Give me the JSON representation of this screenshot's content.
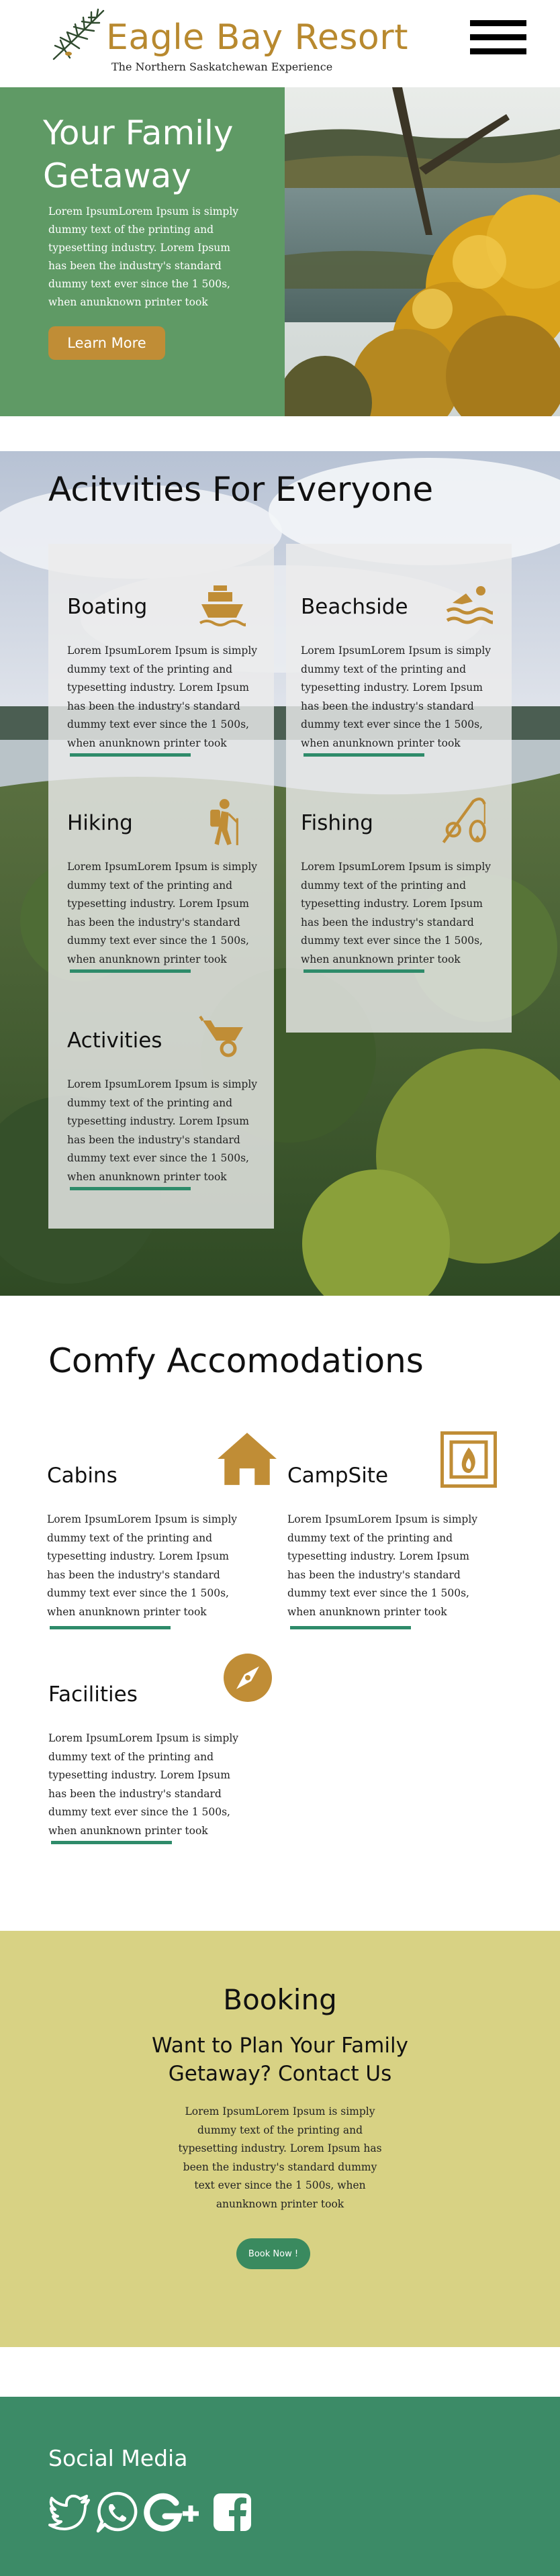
{
  "header": {
    "title": "Eagle Bay Resort",
    "subtitle": "The Northern Saskatchewan Experience",
    "menu_icon": "hamburger-menu-icon"
  },
  "hero": {
    "title": "Your Family Getaway",
    "text": "Lorem IpsumLorem Ipsum is simply  dummy text of the printing and typesetting industry. Lorem Ipsum has been the industry's standard dummy text ever since the 1 500s, when anunknown printer took",
    "button": "Learn More"
  },
  "activities": {
    "title": "Acitvities For Everyone",
    "items": [
      {
        "title": "Boating",
        "icon": "ship-icon",
        "text": "Lorem IpsumLorem Ipsum is simply  dummy text of the printing and typesetting industry. Lorem Ipsum has been the industry's standard dummy text ever since the 1 500s, when anunknown printer took"
      },
      {
        "title": "Beachside",
        "icon": "swimmer-icon",
        "text": "Lorem IpsumLorem Ipsum is simply  dummy text of the printing and typesetting industry. Lorem Ipsum has been the industry's standard dummy text ever since the 1 500s, when anunknown printer took"
      },
      {
        "title": "Hiking",
        "icon": "hiker-icon",
        "text": "Lorem IpsumLorem Ipsum is simply  dummy text of the printing and typesetting industry. Lorem Ipsum has been the industry's standard dummy text ever since the 1 500s, when anunknown printer took"
      },
      {
        "title": "Fishing",
        "icon": "fishing-icon",
        "text": "Lorem IpsumLorem Ipsum is simply  dummy text of the printing and typesetting industry. Lorem Ipsum has been the industry's standard dummy text ever since the 1 500s, when anunknown printer took"
      },
      {
        "title": "Activities",
        "icon": "wheelbarrow-icon",
        "text": "Lorem IpsumLorem Ipsum is simply  dummy text of the printing and typesetting industry. Lorem Ipsum has been the industry's standard dummy text ever since the 1 500s, when anunknown printer took"
      }
    ]
  },
  "accommodations": {
    "title": "Comfy Accomodations",
    "items": [
      {
        "title": "Cabins",
        "icon": "house-icon",
        "text": "Lorem IpsumLorem Ipsum is simply  dummy text of the printing and typesetting industry. Lorem Ipsum has been the industry's standard dummy text ever since the 1 500s, when anunknown printer took"
      },
      {
        "title": "CampSite",
        "icon": "fireplace-icon",
        "text": "Lorem IpsumLorem Ipsum is simply  dummy text of the printing and typesetting industry. Lorem Ipsum has been the industry's standard dummy text ever since the 1 500s, when anunknown printer took"
      },
      {
        "title": "Facilities",
        "icon": "compass-icon",
        "text": "Lorem IpsumLorem Ipsum is simply  dummy text of the printing and typesetting industry. Lorem Ipsum has been the industry's standard dummy text ever since the 1 500s, when anunknown printer took"
      }
    ]
  },
  "booking": {
    "title": "Booking",
    "subtitle": "Want to Plan Your Family Getaway? Contact Us",
    "text": "Lorem IpsumLorem Ipsum is simply dummy text of the printing and typesetting industry. Lorem Ipsum has been the industry's standard dummy text ever since the 1 500s, when anunknown printer took",
    "button": "Book Now !"
  },
  "footer": {
    "title": "Social Media",
    "icons": [
      "twitter-icon",
      "whatsapp-icon",
      "google-plus-icon",
      "facebook-icon"
    ]
  },
  "colors": {
    "gold": "#b8892f",
    "hero_green": "#5f9a65",
    "accent_green": "#2e8b6a",
    "booking_bg": "#d8d284",
    "footer_bg": "#3c8b67"
  }
}
